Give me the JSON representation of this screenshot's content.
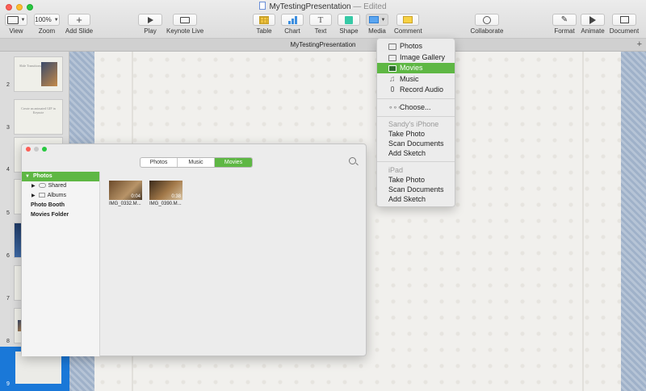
{
  "window": {
    "title": "MyTestingPresentation",
    "title_suffix": "— Edited"
  },
  "toolbar": {
    "view": "View",
    "zoom_value": "100%",
    "zoom": "Zoom",
    "add_slide": "Add Slide",
    "play": "Play",
    "keynote_live": "Keynote Live",
    "table": "Table",
    "chart": "Chart",
    "text": "Text",
    "shape": "Shape",
    "media": "Media",
    "comment": "Comment",
    "collaborate": "Collaborate",
    "format": "Format",
    "animate": "Animate",
    "document": "Document"
  },
  "tab": {
    "title": "MyTestingPresentation",
    "add": "+"
  },
  "navigator": {
    "slides": [
      {
        "number": "2",
        "text": "Slide Transitions"
      },
      {
        "number": "3",
        "text": "Create an animated GIF in Keynote"
      },
      {
        "number": "4",
        "text": ""
      },
      {
        "number": "5",
        "text": ""
      },
      {
        "number": "6",
        "text": ""
      },
      {
        "number": "7",
        "text": ""
      },
      {
        "number": "8",
        "text": ""
      },
      {
        "number": "9",
        "text": ""
      }
    ]
  },
  "media_browser": {
    "tabs": [
      "Photos",
      "Music",
      "Movies"
    ],
    "active_tab": "Movies",
    "sidebar": {
      "header": "Photos",
      "shared": "Shared",
      "albums": "Albums",
      "photo_booth": "Photo Booth",
      "movies_folder": "Movies Folder"
    },
    "movies": [
      {
        "name": "IMG_0332.M...",
        "duration": "0:04"
      },
      {
        "name": "IMG_0390.M...",
        "duration": "0:38"
      }
    ]
  },
  "media_menu": {
    "photos": "Photos",
    "image_gallery": "Image Gallery",
    "movies": "Movies",
    "music": "Music",
    "record_audio": "Record Audio",
    "choose": "Choose...",
    "device1_header": "Sandy's iPhone",
    "device1_take_photo": "Take Photo",
    "device1_scan_documents": "Scan Documents",
    "device1_add_sketch": "Add Sketch",
    "device2_header": "iPad",
    "device2_take_photo": "Take Photo",
    "device2_scan_documents": "Scan Documents",
    "device2_add_sketch": "Add Sketch"
  },
  "colors": {
    "accent_green": "#5eb744",
    "selection_blue": "#1a78d8"
  }
}
